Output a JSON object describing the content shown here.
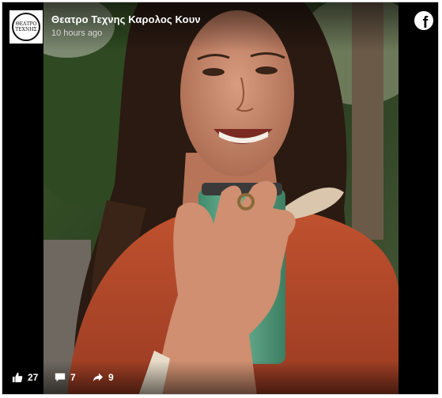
{
  "post": {
    "page_name": "Θεατρο Τεχνης Καρολος Κουν",
    "time": "10 hours ago",
    "avatar_text_line1": "ΘΕΑΤΡΟ",
    "avatar_text_line2": "ΤΕΧΝΗΣ",
    "fb_logo_letter": "f"
  },
  "stats": {
    "likes": "27",
    "comments": "7",
    "shares": "9"
  },
  "icons": {
    "like": "thumbs-up-icon",
    "comment": "comment-icon",
    "share": "share-icon",
    "brand": "facebook-icon"
  },
  "colors": {
    "background": "#000000",
    "text": "#ffffff",
    "sweater": "#b84a2e",
    "cup": "#5fa58a"
  }
}
